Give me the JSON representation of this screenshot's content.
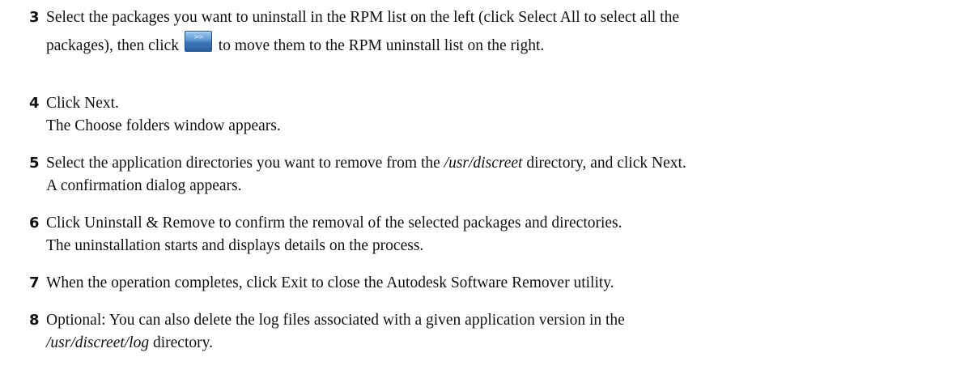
{
  "steps": [
    {
      "number": "3",
      "line1": "Select the packages you want to uninstall in the RPM list on the left (click Select All to select all the",
      "line2_before": "packages), then click",
      "line2_after": "to move them to the RPM uninstall list on the right.",
      "button_glyph": ">>"
    },
    {
      "number": "4",
      "line1": "Click Next.",
      "line2": "The Choose folders window appears."
    },
    {
      "number": "5",
      "line1_before": "Select the application directories you want to remove from the",
      "line1_path": "/usr/discreet",
      "line1_after": "directory, and click Next.",
      "line2": "A confirmation dialog appears."
    },
    {
      "number": "6",
      "line1": "Click Uninstall & Remove to confirm the removal of the selected packages and directories.",
      "line2": "The uninstallation starts and displays details on the process."
    },
    {
      "number": "7",
      "line1": "When the operation completes, click Exit to close the Autodesk Software Remover utility."
    },
    {
      "number": "8",
      "line1": "Optional: You can also delete the log files associated with a given application version in the",
      "line2_path": "/usr/discreet/log",
      "line2_after": "directory."
    }
  ]
}
